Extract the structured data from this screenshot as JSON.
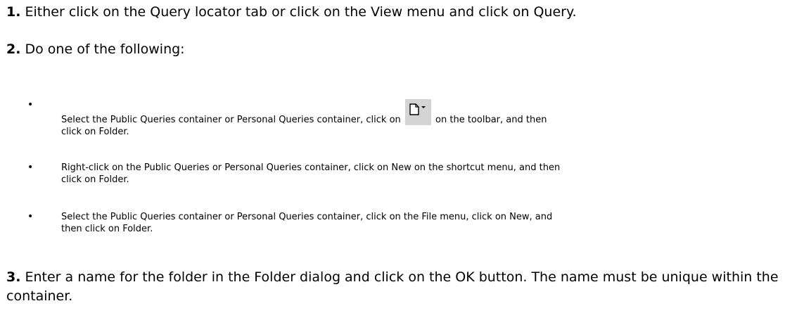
{
  "steps": [
    {
      "number": "1.",
      "text": "Either click on the Query locator tab or click on the View menu and click on Query."
    },
    {
      "number": "2.",
      "text": "Do one of the following:"
    },
    {
      "number": "3.",
      "text": "Enter a name for the folder in the Folder dialog and click on the OK button. The name must be unique within the container."
    }
  ],
  "bullets": [
    {
      "marker": "•",
      "text_before_icon": "Select the Public Queries container or Personal Queries container, click on",
      "icon": "new-document-dropdown-icon",
      "text_after_icon": "on the toolbar, and then",
      "text_line2": "click on Folder."
    },
    {
      "marker": "•",
      "text": "Right-click on the Public Queries or Personal Queries container, click on New on the shortcut menu, and then",
      "text_line2": "click on Folder."
    },
    {
      "marker": "•",
      "text": "Select the Public Queries container or Personal Queries container, click on the File menu, click on New, and",
      "text_line2": "then click on Folder."
    }
  ]
}
